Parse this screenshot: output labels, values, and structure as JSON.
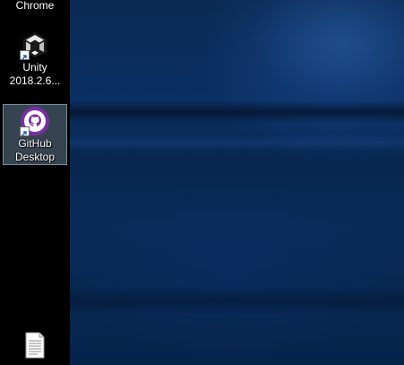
{
  "desktop": {
    "icons": [
      {
        "label": "Chrome",
        "icon": "chrome-icon"
      },
      {
        "label": "Unity\n2018.2.6...",
        "line1": "Unity",
        "line2": "2018.2.6...",
        "icon": "unity-icon"
      },
      {
        "label": "GitHub Desktop",
        "line1": "GitHub",
        "line2": "Desktop",
        "icon": "github-desktop-icon",
        "selected": true
      },
      {
        "label": "",
        "icon": "text-file-icon"
      }
    ]
  },
  "colors": {
    "wallpaper": "#0a2f63",
    "selection": "#7896b4",
    "github_purple": "#7a2ea6"
  }
}
